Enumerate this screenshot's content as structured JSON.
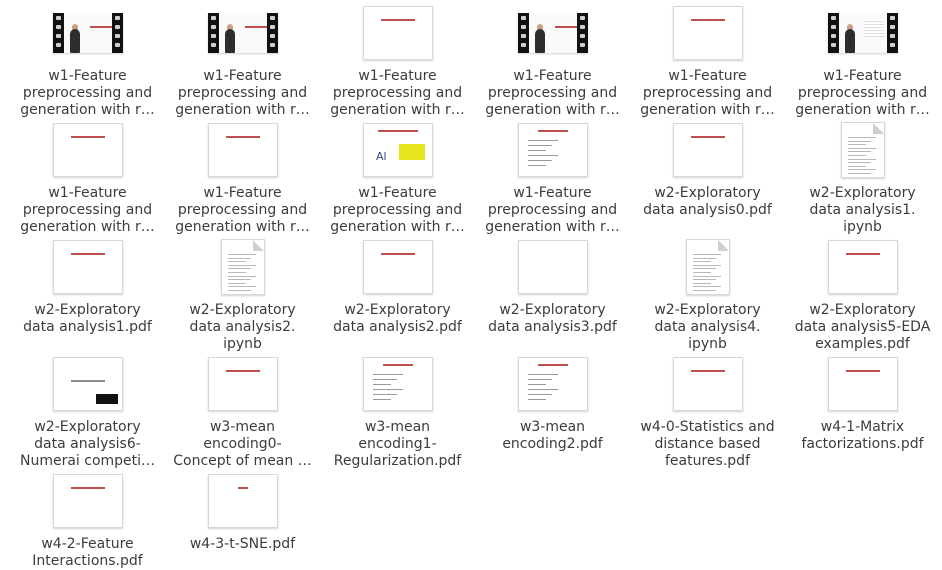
{
  "files": [
    {
      "name": "w1-Feature preprocessing and generation with r…",
      "lines": [
        "w1-Feature",
        "preprocessing and",
        "generation with r…"
      ],
      "thumb": "video-slide"
    },
    {
      "name": "w1-Feature preprocessing and generation with r…",
      "lines": [
        "w1-Feature",
        "preprocessing and",
        "generation with r…"
      ],
      "thumb": "video-slide"
    },
    {
      "name": "w1-Feature preprocessing and generation with r…",
      "lines": [
        "w1-Feature",
        "preprocessing and",
        "generation with r…"
      ],
      "thumb": "slide"
    },
    {
      "name": "w1-Feature preprocessing and generation with r…",
      "lines": [
        "w1-Feature",
        "preprocessing and",
        "generation with r…"
      ],
      "thumb": "video-slide"
    },
    {
      "name": "w1-Feature preprocessing and generation with r…",
      "lines": [
        "w1-Feature",
        "preprocessing and",
        "generation with r…"
      ],
      "thumb": "slide"
    },
    {
      "name": "w1-Feature preprocessing and generation with r…",
      "lines": [
        "w1-Feature",
        "preprocessing and",
        "generation with r…"
      ],
      "thumb": "video-table"
    },
    {
      "name": "w1-Feature preprocessing and generation with r…",
      "lines": [
        "w1-Feature",
        "preprocessing and",
        "generation with r…"
      ],
      "thumb": "slide"
    },
    {
      "name": "w1-Feature preprocessing and generation with r…",
      "lines": [
        "w1-Feature",
        "preprocessing and",
        "generation with r…"
      ],
      "thumb": "slide"
    },
    {
      "name": "w1-Feature preprocessing and generation with r…",
      "lines": [
        "w1-Feature",
        "preprocessing and",
        "generation with r…"
      ],
      "thumb": "slide-image"
    },
    {
      "name": "w1-Feature preprocessing and generation with r…",
      "lines": [
        "w1-Feature",
        "preprocessing and",
        "generation with r…"
      ],
      "thumb": "slide-diagram"
    },
    {
      "name": "w2-Exploratory data analysis0.pdf",
      "lines": [
        "w2-Exploratory",
        "data analysis0.pdf"
      ],
      "thumb": "slide"
    },
    {
      "name": "w2-Exploratory data analysis1.ipynb",
      "lines": [
        "w2-Exploratory",
        "data analysis1.",
        "ipynb"
      ],
      "thumb": "doc"
    },
    {
      "name": "w2-Exploratory data analysis1.pdf",
      "lines": [
        "w2-Exploratory",
        "data analysis1.pdf"
      ],
      "thumb": "slide"
    },
    {
      "name": "w2-Exploratory data analysis2.ipynb",
      "lines": [
        "w2-Exploratory",
        "data analysis2.",
        "ipynb"
      ],
      "thumb": "doc"
    },
    {
      "name": "w2-Exploratory data analysis2.pdf",
      "lines": [
        "w2-Exploratory",
        "data analysis2.pdf"
      ],
      "thumb": "slide"
    },
    {
      "name": "w2-Exploratory data analysis3.pdf",
      "lines": [
        "w2-Exploratory",
        "data analysis3.pdf"
      ],
      "thumb": "slide-blank"
    },
    {
      "name": "w2-Exploratory data analysis4.ipynb",
      "lines": [
        "w2-Exploratory",
        "data analysis4.",
        "ipynb"
      ],
      "thumb": "doc"
    },
    {
      "name": "w2-Exploratory data analysis5-EDA examples.pdf",
      "lines": [
        "w2-Exploratory",
        "data analysis5-EDA",
        "examples.pdf"
      ],
      "thumb": "slide"
    },
    {
      "name": "w2-Exploratory data analysis6-Numerai competi…",
      "lines": [
        "w2-Exploratory",
        "data analysis6-",
        "Numerai competi…"
      ],
      "thumb": "slide-numerai"
    },
    {
      "name": "w3-mean encoding0-Concept of mean …",
      "lines": [
        "w3-mean",
        "encoding0-",
        "Concept of mean …"
      ],
      "thumb": "slide"
    },
    {
      "name": "w3-mean encoding1-Regularization.pdf",
      "lines": [
        "w3-mean",
        "encoding1-",
        "Regularization.pdf"
      ],
      "thumb": "slide-list"
    },
    {
      "name": "w3-mean encoding2.pdf",
      "lines": [
        "w3-mean",
        "encoding2.pdf"
      ],
      "thumb": "slide-list"
    },
    {
      "name": "w4-0-Statistics and distance based features.pdf",
      "lines": [
        "w4-0-Statistics and",
        "distance based",
        "features.pdf"
      ],
      "thumb": "slide"
    },
    {
      "name": "w4-1-Matrix factorizations.pdf",
      "lines": [
        "w4-1-Matrix",
        "factorizations.pdf"
      ],
      "thumb": "slide"
    },
    {
      "name": "w4-2-Feature Interactions.pdf",
      "lines": [
        "w4-2-Feature",
        "Interactions.pdf"
      ],
      "thumb": "slide"
    },
    {
      "name": "w4-3-t-SNE.pdf",
      "lines": [
        "w4-3-t-SNE.pdf"
      ],
      "thumb": "slide-small"
    }
  ],
  "colors": {
    "label": "#3c3c3c",
    "slide_title": "#b33030",
    "background": "#ffffff"
  }
}
